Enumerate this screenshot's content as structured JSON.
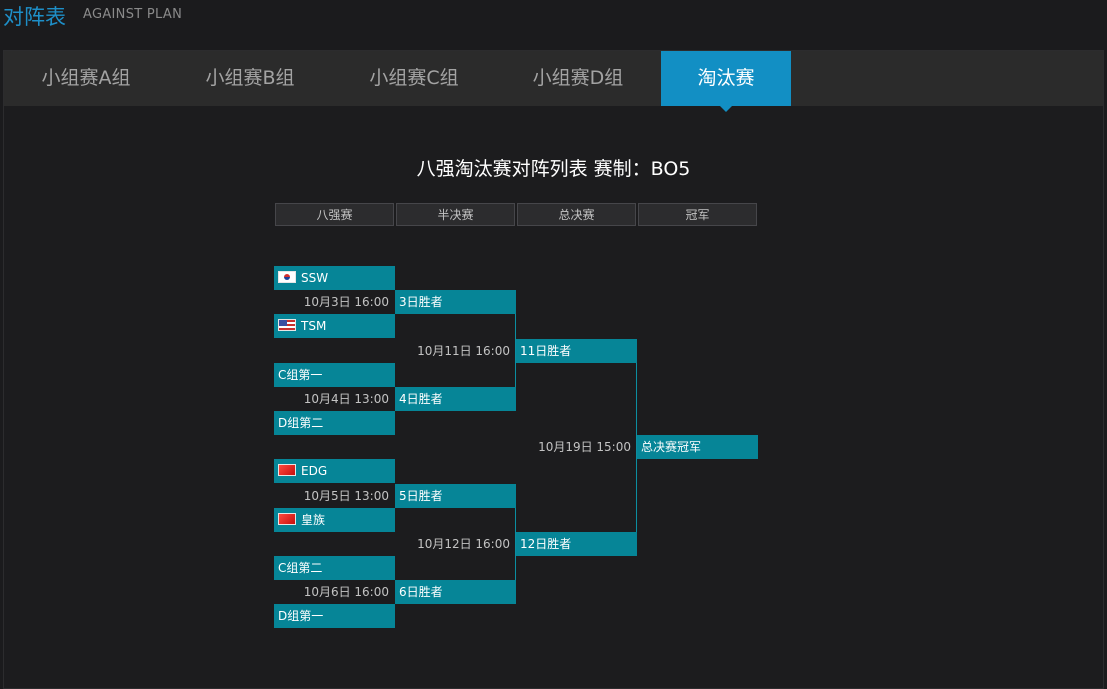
{
  "header": {
    "title_cn": "对阵表",
    "title_en": "AGAINST PLAN"
  },
  "tabs": [
    {
      "label": "小组赛A组"
    },
    {
      "label": "小组赛B组"
    },
    {
      "label": "小组赛C组"
    },
    {
      "label": "小组赛D组"
    },
    {
      "label": "淘汰赛",
      "active": true
    }
  ],
  "bracket": {
    "title": "八强淘汰赛对阵列表 赛制：BO5",
    "rounds": [
      "八强赛",
      "半决赛",
      "总决赛",
      "冠军"
    ],
    "teams": [
      {
        "name": "SSW",
        "flag": "korea-flag-icon"
      },
      {
        "name": "TSM",
        "flag": "usa-flag-icon"
      },
      {
        "name": "C组第一"
      },
      {
        "name": "D组第二"
      },
      {
        "name": "EDG",
        "flag": "china-flag-icon"
      },
      {
        "name": "皇族",
        "flag": "china-flag-icon"
      },
      {
        "name": "C组第二"
      },
      {
        "name": "D组第一"
      }
    ],
    "quarterfinals": [
      {
        "time": "10月3日 16:00",
        "winner": "3日胜者"
      },
      {
        "time": "10月4日 13:00",
        "winner": "4日胜者"
      },
      {
        "time": "10月5日 13:00",
        "winner": "5日胜者"
      },
      {
        "time": "10月6日 16:00",
        "winner": "6日胜者"
      }
    ],
    "semifinals": [
      {
        "time": "10月11日 16:00",
        "winner": "11日胜者"
      },
      {
        "time": "10月12日 16:00",
        "winner": "12日胜者"
      }
    ],
    "final": {
      "time": "10月19日 15:00",
      "winner": "总决赛冠军"
    }
  },
  "colors": {
    "accent": "#128fc4",
    "slot": "#068597",
    "background": "#1b1b1d"
  }
}
